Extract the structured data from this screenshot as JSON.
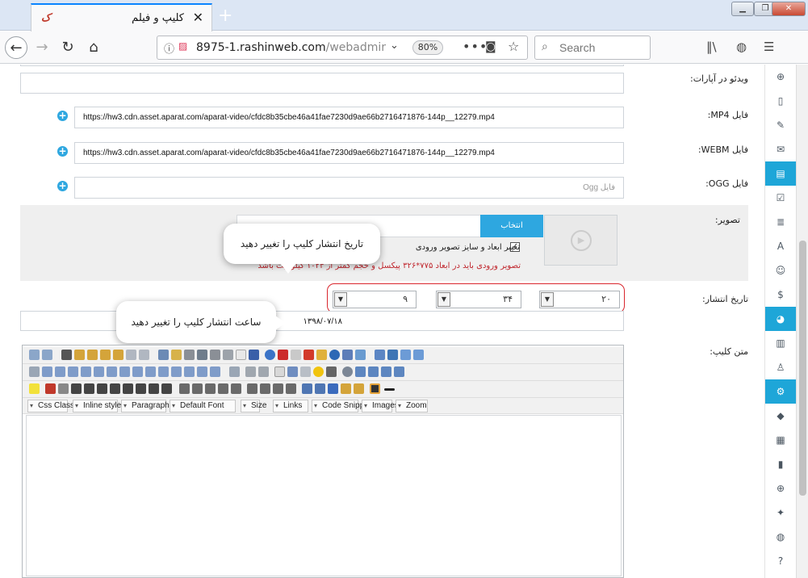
{
  "browser": {
    "tab_title": "کلیپ و فیلم",
    "tab_close": "✕",
    "new_tab": "+",
    "url_host": "8975-1.rashinweb.com",
    "url_path": "/webadmin/cl",
    "zoom": "80%",
    "search_placeholder": "Search",
    "window_minimize": "▁",
    "window_restore": "❐",
    "window_close": "✕"
  },
  "form": {
    "aparat_label": "ویدئو در آپارات:",
    "mp4_label": "فایل MP4:",
    "mp4_value": "https://hw3.cdn.asset.aparat.com/aparat-video/cfdc8b35cbe46a41fae7230d9ae66b2716471876-144p__12279.mp4",
    "webm_label": "فایل WEBM:",
    "webm_value": "https://hw3.cdn.asset.aparat.com/aparat-video/cfdc8b35cbe46a41fae7230d9ae66b2716471876-144p__12279.mp4",
    "ogg_label": "فایل OGG:",
    "ogg_placeholder": "فایل Ogg",
    "image_label": "تصویر:",
    "pick_button": "انتخاب",
    "resize_checkbox_label": "تغییر ابعاد و سایز تصویر ورودی",
    "image_warning": "تصویر ورودی باید در ابعاد ۷۷۵*۳۲۶ پیکسل و حجم کمتر از ۱۰۲۴ کیلوبایت باشد",
    "publish_label": "تاریخ انتشار:",
    "publish_hour": "۲۰",
    "publish_minute": "۳۴",
    "publish_second": "۹",
    "publish_date": "۱۳۹۸/۰۷/۱۸",
    "body_label": "متن کلیپ:"
  },
  "callouts": {
    "date_hint": "تاریخ انتشار کلیپ را تغییر دهید",
    "time_hint": "ساعت انتشار کلیپ را تغییر دهید"
  },
  "editor": {
    "dropdowns": [
      "Css Class",
      "Inline style",
      "Paragraph",
      "Default Font",
      "Size",
      "Links",
      "Code Snippet",
      "Images",
      "Zoom"
    ]
  }
}
